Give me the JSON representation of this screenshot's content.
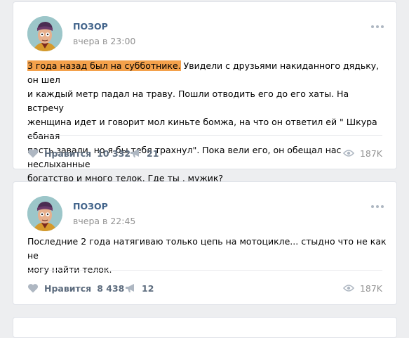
{
  "posts": [
    {
      "author": "ПОЗОР",
      "date": "вчера в 23:00",
      "highlight": "3 года назад был на субботнике.",
      "text": " Увидели с друзьями накиданного дядьку, он шел\nи каждый метр падал на траву. Пошли отводить его до его хаты. На встречу\nженщина идет и говорит мол киньте бомжа, на что он ответил ей \" Шкура ебаная\nпасть завали, но я бы тебя трахнул\". Пока вели его, он обещал нас неслыханные\nбогатство и много телок. Где ты , мужик?",
      "like_label": "Нравится",
      "likes": "10 332",
      "shares": "21",
      "views": "187K"
    },
    {
      "author": "ПОЗОР",
      "date": "вчера в 22:45",
      "text": "Последние 2 года натягиваю только цепь на мотоцикле... стыдно что не как не\nмогу найти телок.",
      "like_label": "Нравится",
      "likes": "8 438",
      "shares": "12",
      "views": "187K"
    }
  ],
  "colors": {
    "background": "#edeef0",
    "author": "#42648b",
    "highlight": "#f4a14b",
    "muted": "#939393",
    "action": "#5d6c7e",
    "icon": "#aeb7c2"
  },
  "icons": [
    "heart-icon",
    "megaphone-icon",
    "eye-icon",
    "more-dots-icon"
  ]
}
